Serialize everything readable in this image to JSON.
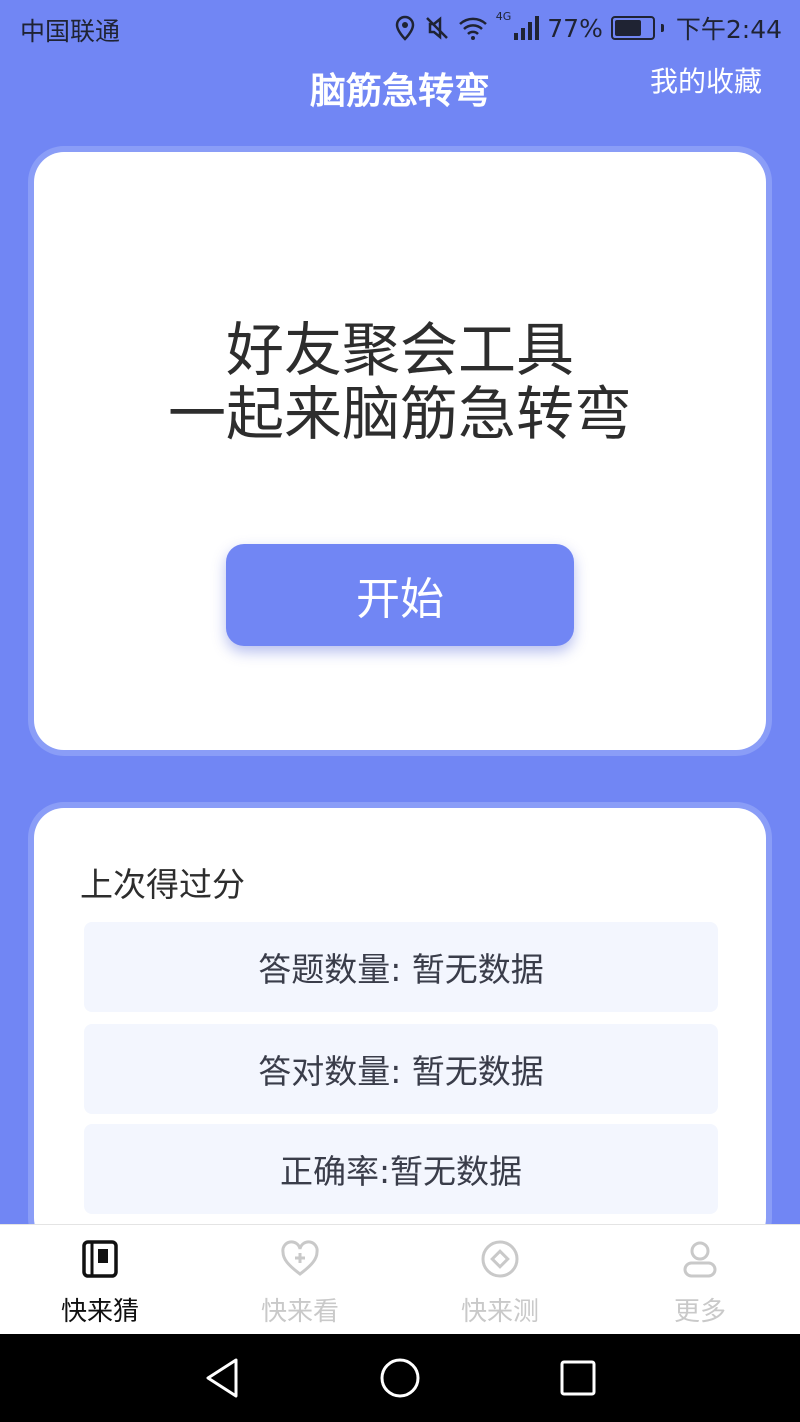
{
  "status_bar": {
    "carrier": "中国联通",
    "network": "4G",
    "battery": "77%",
    "battery_level": 0.77,
    "time": "下午2:44"
  },
  "header": {
    "title": "脑筋急转弯",
    "favorites_label": "我的收藏"
  },
  "hero": {
    "line1": "好友聚会工具",
    "line2": "一起来脑筋急转弯",
    "start_label": "开始"
  },
  "stats": {
    "section_title": "上次得过分",
    "rows": [
      "答题数量: 暂无数据",
      "答对数量: 暂无数据",
      "正确率:暂无数据"
    ]
  },
  "tabbar": {
    "tabs": [
      {
        "label": "快来猜",
        "icon": "book-icon",
        "active": true
      },
      {
        "label": "快来看",
        "icon": "heart-plus-icon",
        "active": false
      },
      {
        "label": "快来测",
        "icon": "diamond-circle-icon",
        "active": false
      },
      {
        "label": "更多",
        "icon": "user-icon",
        "active": false
      }
    ]
  },
  "colors": {
    "accent": "#7186f4",
    "card": "#ffffff",
    "stat_row_bg": "#f3f6fe",
    "tab_active": "#111111",
    "tab_inactive": "#c9c9c9"
  }
}
